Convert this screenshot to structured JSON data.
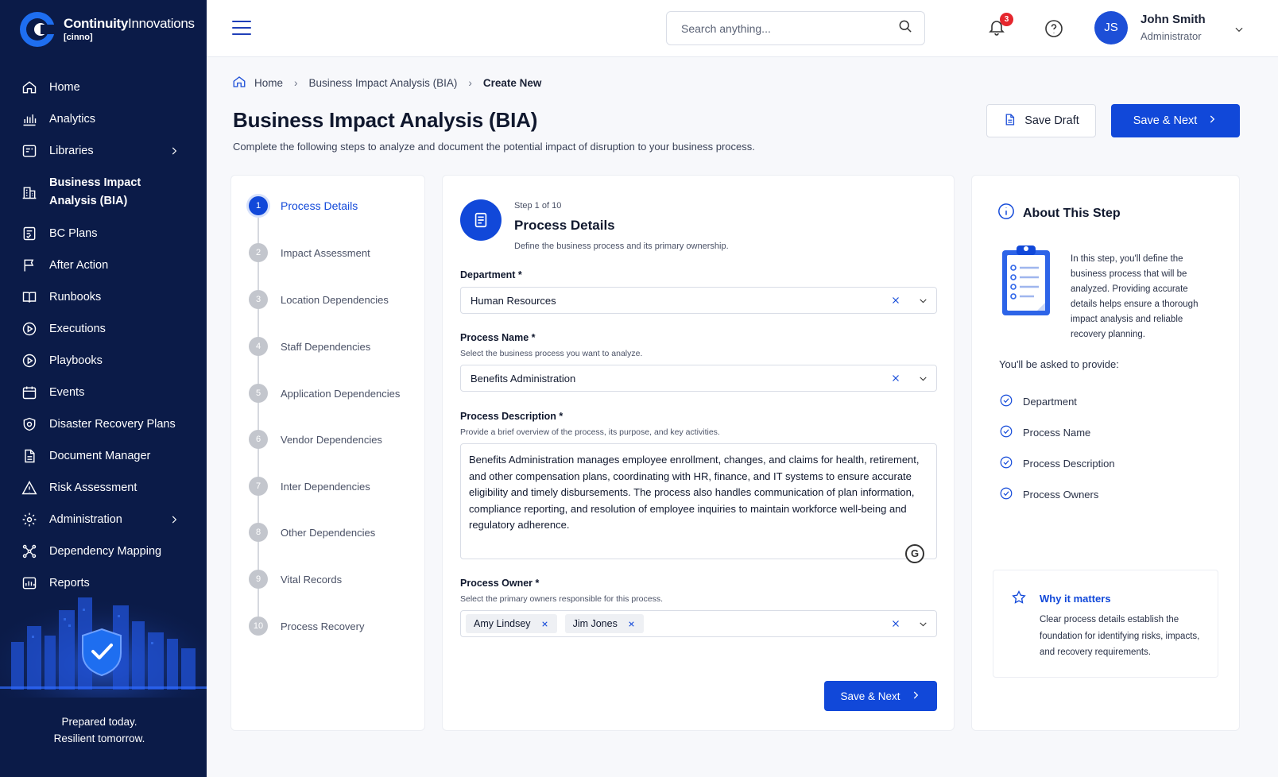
{
  "brand": {
    "name_bold": "Continuity",
    "name_light": "Innovations",
    "sub": "[cinno]"
  },
  "sidebar": {
    "items": [
      {
        "label": "Home",
        "icon": "home-icon"
      },
      {
        "label": "Analytics",
        "icon": "chart-icon"
      },
      {
        "label": "Libraries",
        "icon": "library-icon"
      },
      {
        "label": "Business Impact Analysis (BIA)",
        "icon": "building-icon"
      },
      {
        "label": "BC Plans",
        "icon": "plan-icon"
      },
      {
        "label": "After Action",
        "icon": "flag-icon"
      },
      {
        "label": "Runbooks",
        "icon": "book-icon"
      },
      {
        "label": "Executions",
        "icon": "play-circle-icon"
      },
      {
        "label": "Playbooks",
        "icon": "play-circle-icon"
      },
      {
        "label": "Events",
        "icon": "calendar-icon"
      },
      {
        "label": "Disaster Recovery Plans",
        "icon": "shield-icon"
      },
      {
        "label": "Document Manager",
        "icon": "document-icon"
      },
      {
        "label": "Risk Assessment",
        "icon": "warning-icon"
      },
      {
        "label": "Administration",
        "icon": "gear-icon"
      },
      {
        "label": "Dependency Mapping",
        "icon": "network-icon"
      },
      {
        "label": "Reports",
        "icon": "report-icon"
      }
    ],
    "tagline_1": "Prepared today.",
    "tagline_2": "Resilient tomorrow."
  },
  "topbar": {
    "search_placeholder": "Search anything...",
    "notification_count": "3",
    "user_initials": "JS",
    "user_name": "John Smith",
    "user_role": "Administrator"
  },
  "breadcrumb": {
    "home": "Home",
    "section": "Business Impact Analysis (BIA)",
    "current": "Create New"
  },
  "page": {
    "title": "Business Impact Analysis (BIA)",
    "subtitle": "Complete the following steps to analyze and document the potential impact of disruption to your business process.",
    "save_draft": "Save Draft",
    "save_next": "Save & Next"
  },
  "steps": [
    {
      "num": "1",
      "label": "Process Details"
    },
    {
      "num": "2",
      "label": "Impact Assessment"
    },
    {
      "num": "3",
      "label": "Location Dependencies"
    },
    {
      "num": "4",
      "label": "Staff Dependencies"
    },
    {
      "num": "5",
      "label": "Application Dependencies"
    },
    {
      "num": "6",
      "label": "Vendor Dependencies"
    },
    {
      "num": "7",
      "label": "Inter Dependencies"
    },
    {
      "num": "8",
      "label": "Other Dependencies"
    },
    {
      "num": "9",
      "label": "Vital Records"
    },
    {
      "num": "10",
      "label": "Process Recovery"
    }
  ],
  "form": {
    "step_of": "Step 1 of 10",
    "title": "Process Details",
    "description": "Define the business process and its primary ownership.",
    "department": {
      "label": "Department *",
      "value": "Human Resources"
    },
    "process_name": {
      "label": "Process Name *",
      "help": "Select the business process you want to analyze.",
      "value": "Benefits Administration"
    },
    "process_description": {
      "label": "Process Description *",
      "help": "Provide a brief overview of the process, its purpose, and key activities.",
      "value": "Benefits Administration manages employee enrollment, changes, and claims for health, retirement, and other compensation plans, coordinating with HR, finance, and IT systems to ensure accurate eligibility and timely disbursements. The process also handles communication of plan information, compliance reporting, and resolution of employee inquiries to maintain workforce well-being and regulatory adherence.",
      "grammar_badge": "G"
    },
    "process_owner": {
      "label": "Process Owner *",
      "help": "Select the primary owners responsible for this process.",
      "chips": [
        "Amy Lindsey",
        "Jim Jones"
      ]
    },
    "save_next": "Save & Next"
  },
  "about": {
    "title": "About This Step",
    "text": "In this step, you'll define the business process that will be analyzed. Providing accurate details helps ensure a thorough impact analysis and reliable recovery planning.",
    "asked_label": "You'll be asked to provide:",
    "items": [
      "Department",
      "Process Name",
      "Process Description",
      "Process Owners"
    ],
    "why_title": "Why it matters",
    "why_text": "Clear process details establish the foundation for identifying risks, impacts, and recovery requirements."
  },
  "colors": {
    "sidebar_bg": "#0b1b48",
    "accent": "#1148d9",
    "badge": "#e5262d"
  }
}
